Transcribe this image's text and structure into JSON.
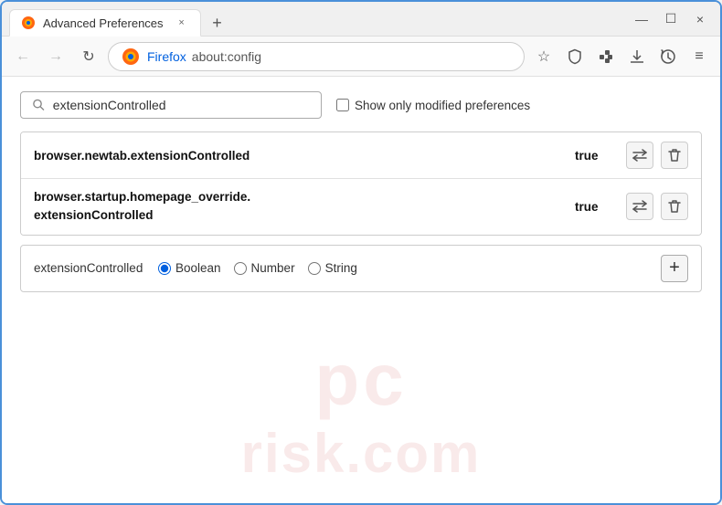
{
  "window": {
    "title": "Advanced Preferences",
    "tab_label": "Advanced Preferences",
    "new_tab_symbol": "+",
    "close_symbol": "×"
  },
  "nav": {
    "back_label": "←",
    "forward_label": "→",
    "reload_label": "↻",
    "firefox_label": "Firefox",
    "url": "about:config",
    "bookmark_symbol": "☆",
    "shield_symbol": "🛡",
    "extension_symbol": "🧩",
    "downloads_symbol": "📥",
    "history_symbol": "⟳",
    "menu_symbol": "≡"
  },
  "search": {
    "placeholder": "extensionControlled",
    "value": "extensionControlled",
    "show_modified_label": "Show only modified preferences"
  },
  "results": [
    {
      "name": "browser.newtab.extensionControlled",
      "value": "true"
    },
    {
      "name_line1": "browser.startup.homepage_override.",
      "name_line2": "extensionControlled",
      "value": "true"
    }
  ],
  "new_pref": {
    "name": "extensionControlled",
    "types": [
      {
        "label": "Boolean",
        "value": "boolean",
        "checked": true
      },
      {
        "label": "Number",
        "value": "number",
        "checked": false
      },
      {
        "label": "String",
        "value": "string",
        "checked": false
      }
    ],
    "add_symbol": "+"
  },
  "watermark": {
    "line1": "pc",
    "line2": "risk.com"
  }
}
